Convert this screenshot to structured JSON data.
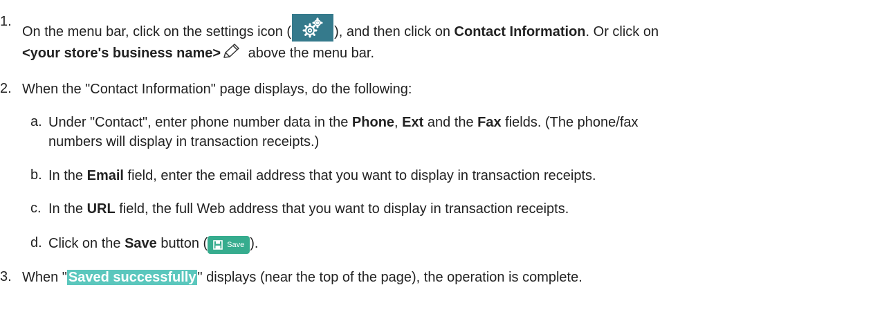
{
  "steps": {
    "s1": {
      "num": "1.",
      "a": "On the menu bar, click on the settings icon (",
      "b": "), and then click on ",
      "c": "Contact Information",
      "d": ".  Or click on",
      "e": "<your store's business name>",
      "f": " above the menu bar."
    },
    "s2": {
      "num": "2.",
      "text": "When the \"Contact Information\" page displays, do the following:"
    },
    "s2a": {
      "num": "a.",
      "a": "Under \"Contact\", enter phone number data in the ",
      "b": "Phone",
      "c": ", ",
      "d": "Ext",
      "e": " and the ",
      "f": "Fax",
      "g": " fields. (The phone/fax",
      "h": "numbers will display in transaction receipts.)"
    },
    "s2b": {
      "num": "b.",
      "a": "In the ",
      "b": "Email",
      "c": " field, enter the email address that you want to display in transaction receipts."
    },
    "s2c": {
      "num": "c.",
      "a": "In the ",
      "b": "URL",
      "c": " field, the full Web address that you want to display in transaction receipts."
    },
    "s2d": {
      "num": "d.",
      "a": "Click on the ",
      "b": "Save",
      "c": " button (",
      "btn": "Save",
      "d": ")."
    },
    "s3": {
      "num": "3.",
      "a": "When \"",
      "b": "Saved successfully",
      "c": "\" displays (near the top of the page), the operation is complete."
    }
  },
  "icons": {
    "settings": "gear-icon",
    "edit": "pencil-icon",
    "save": "floppy-disk-icon"
  },
  "colors": {
    "settings_button": "#357a8c",
    "save_button": "#36ac8e",
    "success_highlight": "#5bc7bd",
    "text": "#222222"
  }
}
